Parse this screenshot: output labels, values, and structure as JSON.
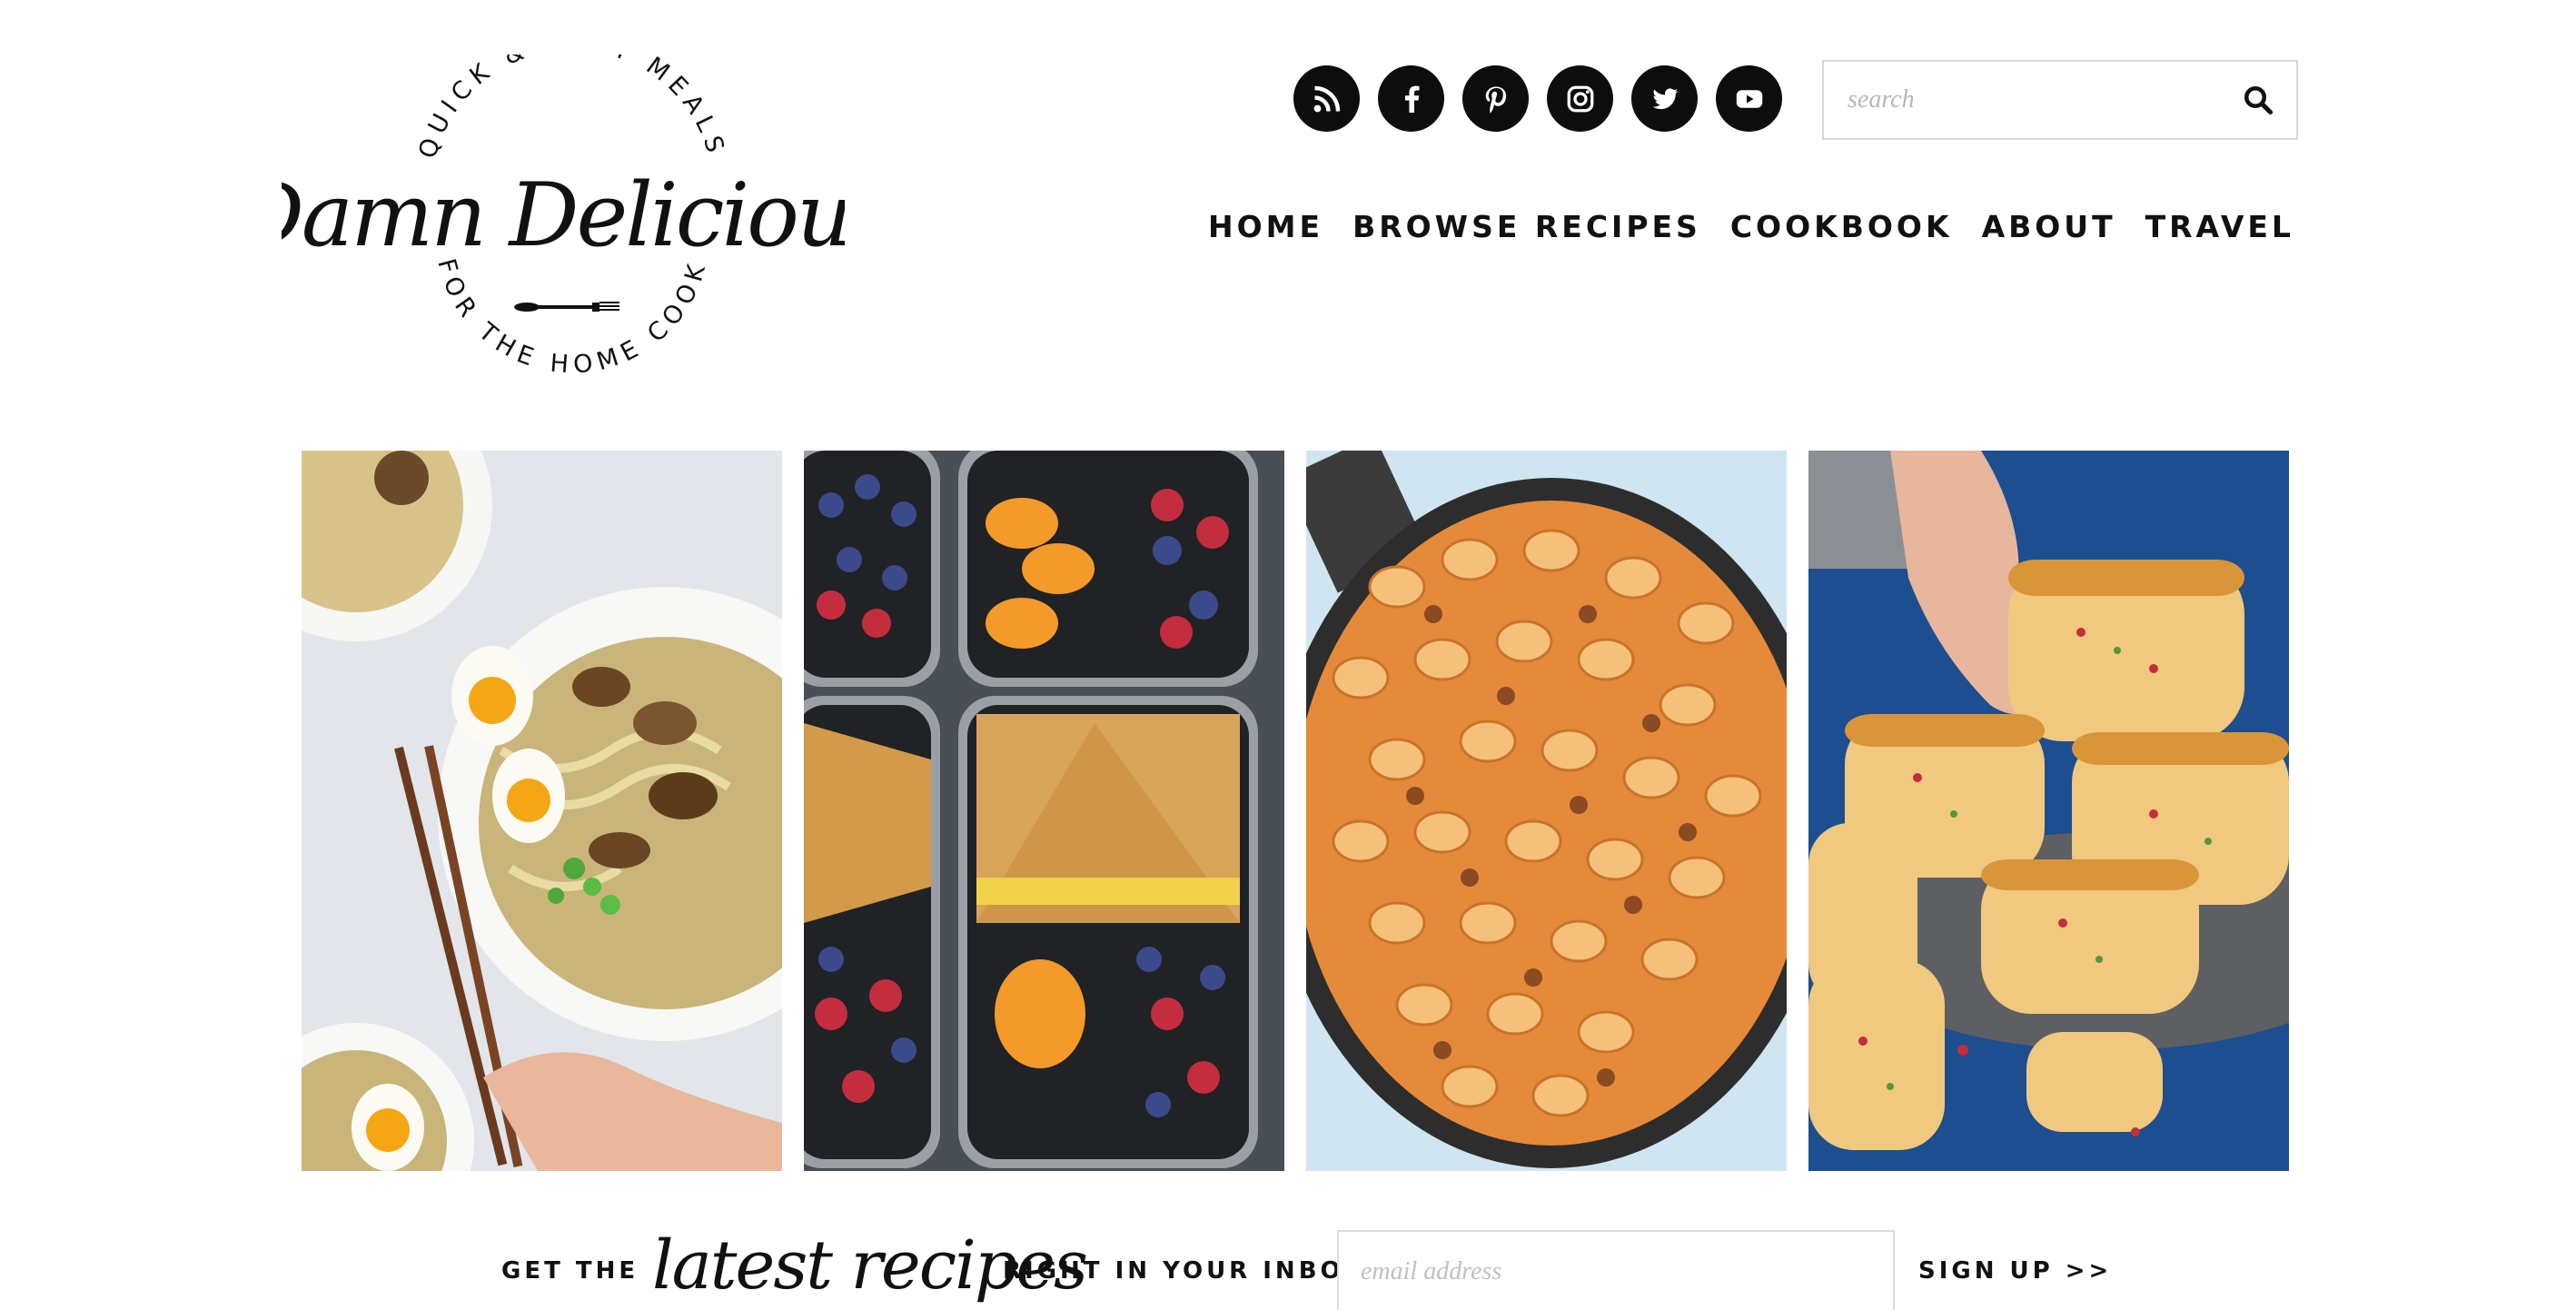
{
  "logo": {
    "top_arc": "QUICK & EASY MEALS",
    "name": "Damn Delicious",
    "bottom_arc": "FOR THE HOME COOK"
  },
  "social": [
    {
      "name": "rss-icon",
      "label": "RSS"
    },
    {
      "name": "facebook-icon",
      "label": "Facebook"
    },
    {
      "name": "pinterest-icon",
      "label": "Pinterest"
    },
    {
      "name": "instagram-icon",
      "label": "Instagram"
    },
    {
      "name": "twitter-icon",
      "label": "Twitter"
    },
    {
      "name": "youtube-icon",
      "label": "YouTube"
    }
  ],
  "search": {
    "placeholder": "search"
  },
  "nav": [
    "HOME",
    "BROWSE RECIPES",
    "COOKBOOK",
    "ABOUT",
    "TRAVEL"
  ],
  "newsletter": {
    "prefix": "GET THE",
    "script": "latest recipes",
    "suffix": "RIGHT IN YOUR INBOX:",
    "email_placeholder": "email address",
    "signup": "SIGN UP >>"
  }
}
